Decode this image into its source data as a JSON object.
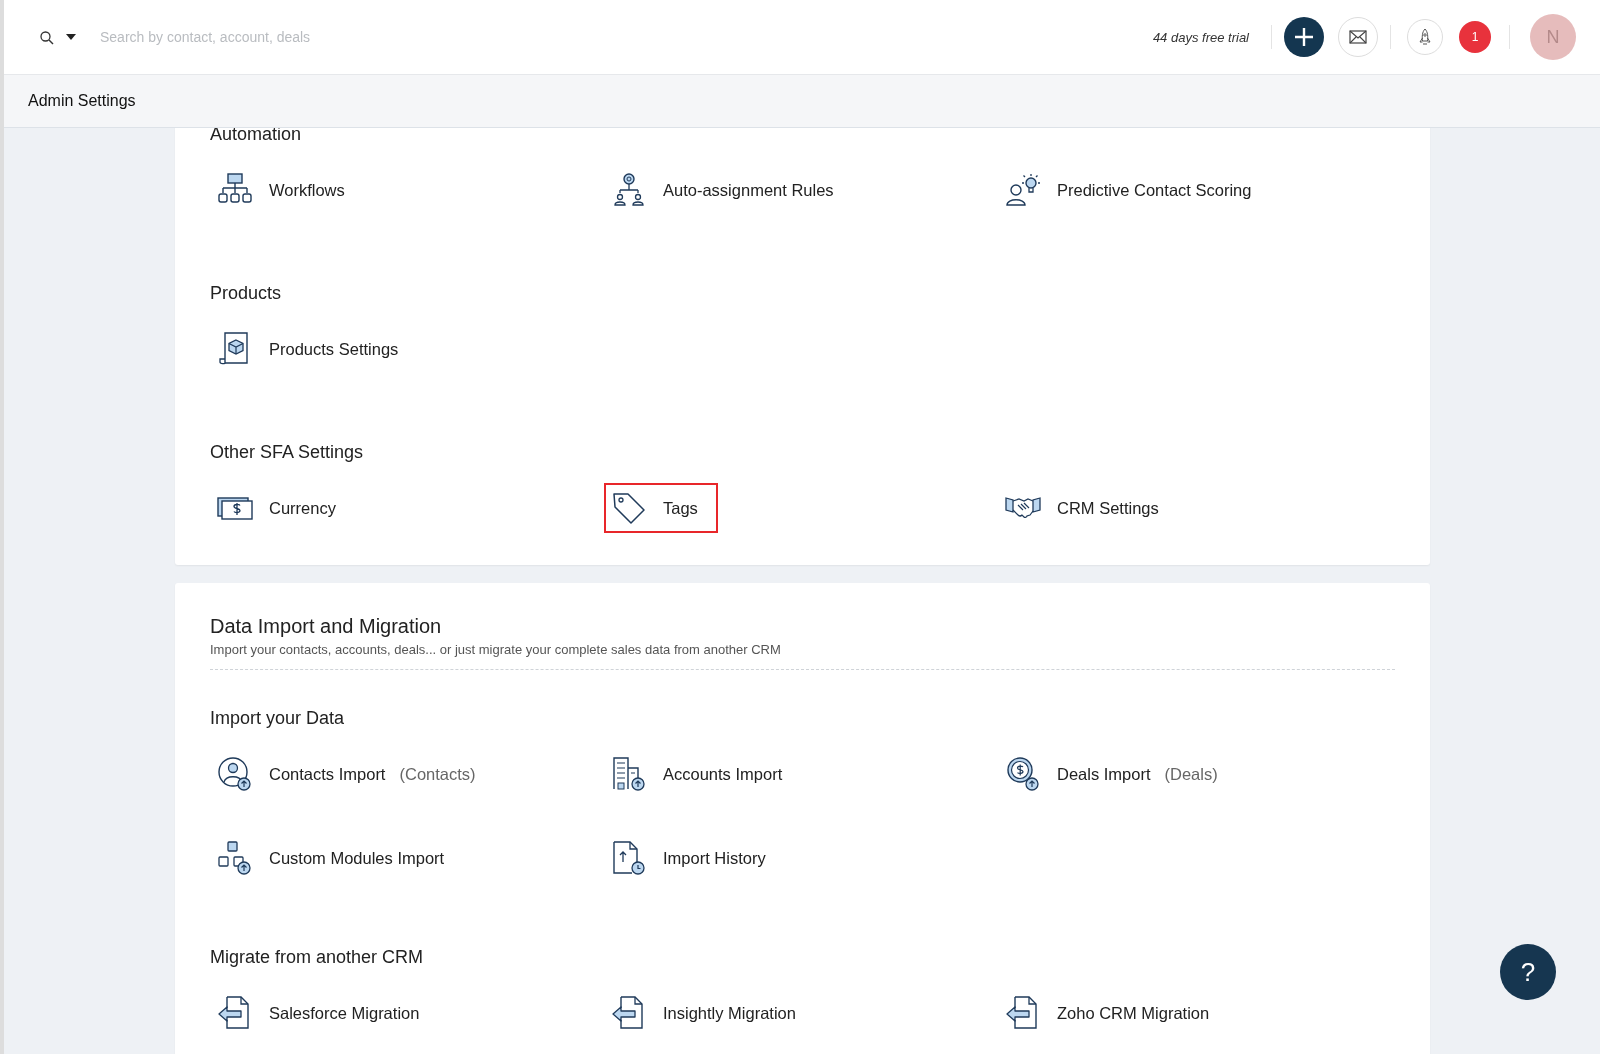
{
  "search": {
    "placeholder": "Search by contact, account, deals"
  },
  "trial": "44 days free trial",
  "notifications": {
    "count": "1"
  },
  "avatar": {
    "initial": "N"
  },
  "page_title": "Admin Settings",
  "cards": [
    {
      "groups": [
        {
          "title": "Automation",
          "items": [
            {
              "label": "Workflows",
              "kind": "workflow",
              "highlighted": false
            },
            {
              "label": "Auto-assignment Rules",
              "kind": "assign",
              "highlighted": false
            },
            {
              "label": "Predictive Contact Scoring",
              "kind": "scoring",
              "highlighted": false
            }
          ]
        },
        {
          "title": "Products",
          "items": [
            {
              "label": "Products Settings",
              "kind": "product",
              "highlighted": false
            }
          ]
        },
        {
          "title": "Other SFA Settings",
          "items": [
            {
              "label": "Currency",
              "kind": "currency",
              "highlighted": false
            },
            {
              "label": "Tags",
              "kind": "tag",
              "highlighted": true
            },
            {
              "label": "CRM Settings",
              "kind": "handshake",
              "highlighted": false
            }
          ]
        }
      ]
    },
    {
      "title": "Data Import and Migration",
      "subtitle": "Import your contacts, accounts, deals... or just migrate your complete sales data from another CRM",
      "groups": [
        {
          "title": "Import your Data",
          "items": [
            {
              "label": "Contacts Import",
              "note": "(Contacts)",
              "kind": "contact-import",
              "highlighted": false
            },
            {
              "label": "Accounts Import",
              "kind": "account-import",
              "highlighted": false
            },
            {
              "label": "Deals Import",
              "note": "(Deals)",
              "kind": "deal-import",
              "highlighted": false
            },
            {
              "label": "Custom Modules Import",
              "kind": "module-import",
              "highlighted": false
            },
            {
              "label": "Import History",
              "kind": "history",
              "highlighted": false
            }
          ]
        },
        {
          "title": "Migrate from another CRM",
          "items": [
            {
              "label": "Salesforce Migration",
              "kind": "migrate",
              "highlighted": false
            },
            {
              "label": "Insightly Migration",
              "kind": "migrate",
              "highlighted": false
            },
            {
              "label": "Zoho CRM Migration",
              "kind": "migrate",
              "highlighted": false
            }
          ]
        }
      ]
    }
  ],
  "help": {
    "label": "?"
  }
}
